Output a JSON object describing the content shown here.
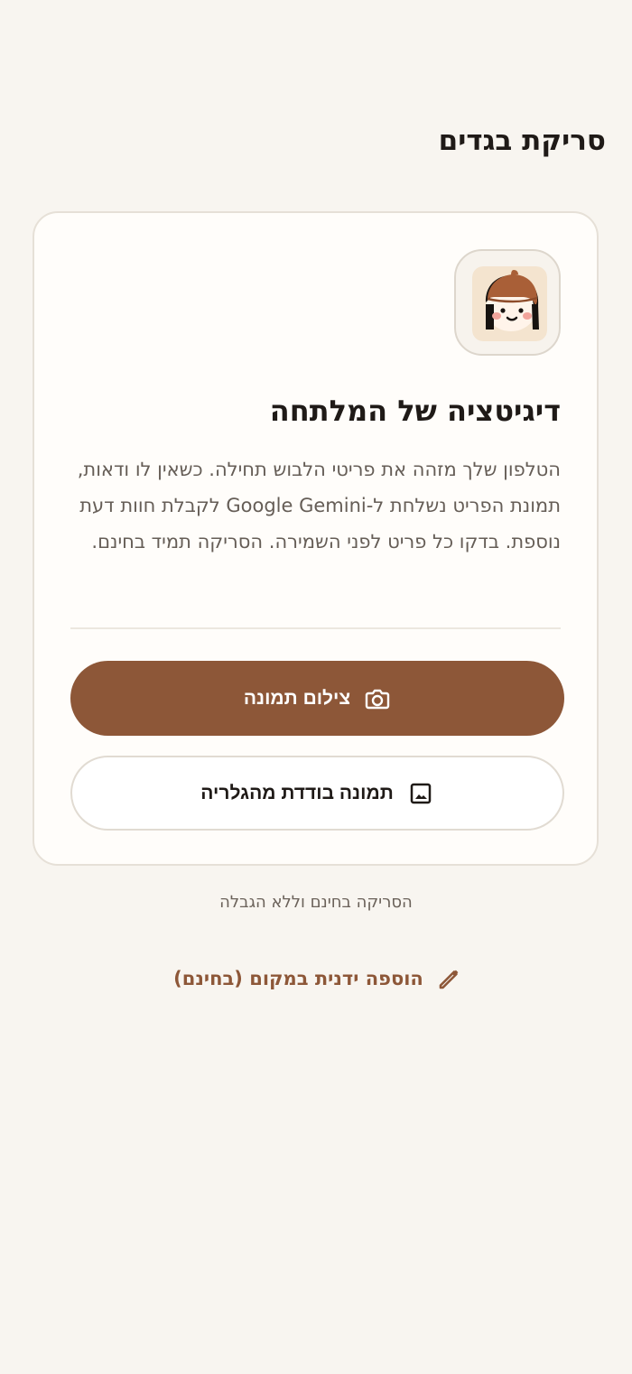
{
  "header": {
    "title": "סריקת בגדים"
  },
  "card": {
    "icon": "character-avatar-icon",
    "title": "דיגיטציה של המלתחה",
    "description": "הטלפון שלך מזהה את פריטי הלבוש תחילה. כשאין לו ודאות, תמונת הפריט נשלחת ל-Google Gemini לקבלת חוות דעת נוספת. בדקו כל פריט לפני השמירה. הסריקה תמיד בחינם."
  },
  "actions": {
    "take_photo": {
      "label": "צילום תמונה",
      "icon": "camera-icon"
    },
    "gallery": {
      "label": "תמונה בודדת מהגלריה",
      "icon": "image-icon"
    }
  },
  "footer": {
    "note": "הסריקה בחינם וללא הגבלה",
    "manual_add": {
      "label": "הוספה ידנית במקום (בחינם)",
      "icon": "pencil-icon"
    }
  },
  "colors": {
    "background": "#f8f5f0",
    "card": "#fffdfa",
    "accent": "#8d5738",
    "text": "#1f1a17",
    "muted_text": "#655d56",
    "border": "#e1dbd2"
  }
}
